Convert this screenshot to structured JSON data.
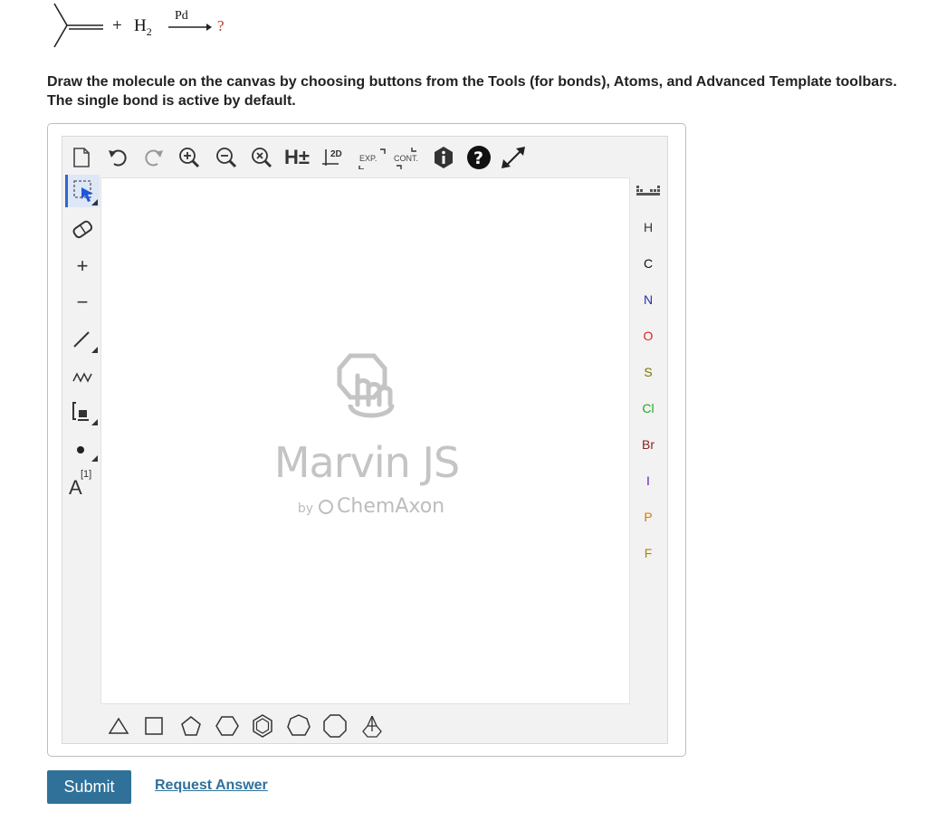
{
  "reaction": {
    "plus": "+",
    "reagent": "H",
    "reagent_subscript": "2",
    "catalyst": "Pd",
    "product": "?"
  },
  "instructions": "Draw the molecule on the canvas by choosing buttons from the Tools (for bonds), Atoms, and Advanced Template toolbars. The single bond is active by default.",
  "top_toolbar": {
    "h_label": "H±",
    "clean2d_label": "2D",
    "expand_label": "EXP.",
    "contract_label": "CONT."
  },
  "left_toolbar": {
    "atom_map_label": "A",
    "atom_map_index": "[1]",
    "plus_label": "+",
    "minus_label": "−"
  },
  "atoms": [
    {
      "symbol": "H",
      "color": "#333333"
    },
    {
      "symbol": "C",
      "color": "#111111"
    },
    {
      "symbol": "N",
      "color": "#2233aa"
    },
    {
      "symbol": "O",
      "color": "#dd2222"
    },
    {
      "symbol": "S",
      "color": "#777700"
    },
    {
      "symbol": "Cl",
      "color": "#22aa22"
    },
    {
      "symbol": "Br",
      "color": "#882222"
    },
    {
      "symbol": "I",
      "color": "#6622aa"
    },
    {
      "symbol": "P",
      "color": "#dd7700"
    },
    {
      "symbol": "F",
      "color": "#aa8800"
    }
  ],
  "watermark": {
    "title": "Marvin JS",
    "by": "by",
    "company": "ChemAxon"
  },
  "buttons": {
    "submit": "Submit",
    "request_answer": "Request Answer"
  },
  "colors": {
    "accent": "#2f7199",
    "active_tool": "#3366cc",
    "question_mark": "#c0392b"
  }
}
